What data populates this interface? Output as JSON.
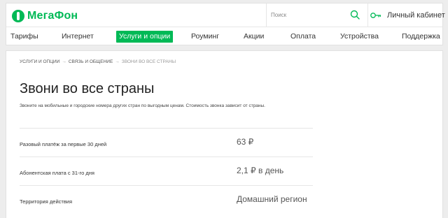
{
  "header": {
    "logo_text": "МегаФон",
    "search": {
      "placeholder": "Поиск"
    },
    "cabinet_label": "Личный кабинет"
  },
  "nav": {
    "items": [
      {
        "label": "Тарифы"
      },
      {
        "label": "Интернет"
      },
      {
        "label": "Услуги и опции",
        "active": true
      },
      {
        "label": "Роуминг"
      },
      {
        "label": "Акции"
      },
      {
        "label": "Оплата"
      },
      {
        "label": "Устройства"
      },
      {
        "label": "Поддержка"
      }
    ]
  },
  "breadcrumb": {
    "items": [
      "УСЛУГИ И ОПЦИИ",
      "СВЯЗЬ И ОБЩЕНИЕ",
      "ЗВОНИ ВО ВСЕ СТРАНЫ"
    ],
    "separator": "→"
  },
  "page": {
    "title": "Звони во все страны",
    "description": "Звоните на мобильные и городские номера других стран по выгодным ценам. Стоимость звонка зависит от страны."
  },
  "details": {
    "rows": [
      {
        "label": "Разовый платёж за первые 30 дней",
        "value": "63 ₽"
      },
      {
        "label": "Абонентская плата с 31-го дня",
        "value": "2,1 ₽ в день"
      },
      {
        "label": "Территория действия",
        "value": "Домашний регион"
      }
    ]
  },
  "colors": {
    "brand": "#00b956",
    "background": "#ededed"
  }
}
